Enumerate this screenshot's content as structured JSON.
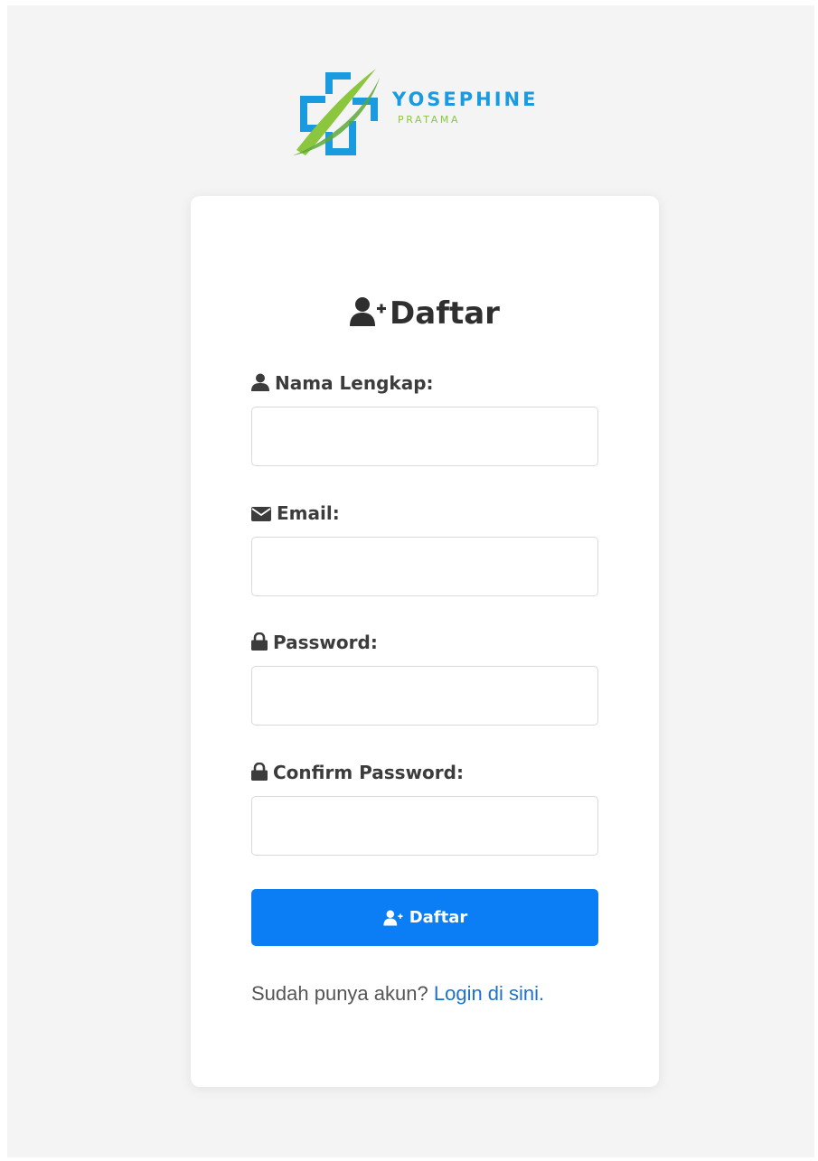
{
  "brand": {
    "name": "YOSEPHINE",
    "subtitle": "PRATAMA",
    "colors": {
      "blue": "#1a9be0",
      "green": "#8cc63f"
    }
  },
  "form": {
    "title": "Daftar",
    "title_icon": "user-plus-icon",
    "fields": [
      {
        "label": "Nama Lengkap:",
        "icon": "user-icon",
        "value": ""
      },
      {
        "label": "Email:",
        "icon": "envelope-icon",
        "value": ""
      },
      {
        "label": "Password:",
        "icon": "lock-icon",
        "value": ""
      },
      {
        "label": "Confirm Password:",
        "icon": "lock-icon",
        "value": ""
      }
    ],
    "submit_label": "Daftar",
    "submit_icon": "user-plus-icon",
    "accent_color": "#0b7ef5"
  },
  "footer": {
    "prompt": "Sudah punya akun?",
    "link_text": "Login di sini."
  }
}
